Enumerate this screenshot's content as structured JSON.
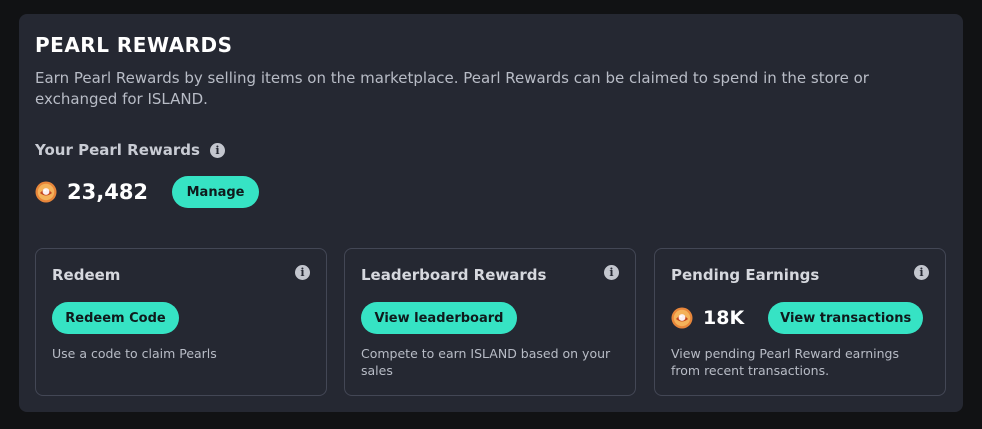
{
  "panel": {
    "title": "PEARL REWARDS",
    "description": "Earn Pearl Rewards by selling items on the marketplace. Pearl Rewards can be claimed to spend in the store or exchanged for ISLAND."
  },
  "your_rewards": {
    "label": "Your Pearl Rewards",
    "balance": "23,482",
    "manage_label": "Manage"
  },
  "cards": [
    {
      "title": "Redeem",
      "button_label": "Redeem Code",
      "text": "Use a code to claim Pearls"
    },
    {
      "title": "Leaderboard Rewards",
      "button_label": "View leaderboard",
      "text": "Compete to earn ISLAND based on your sales"
    },
    {
      "title": "Pending Earnings",
      "pending_value": "18K",
      "button_label": "View transactions",
      "text": "View pending Pearl Reward earnings from recent transactions."
    }
  ],
  "icons": {
    "info": "info-icon",
    "pearl": "pearl-coin-icon"
  },
  "colors": {
    "background": "#111214",
    "panel": "#252832",
    "accent": "#36e3c4",
    "card_border": "#434755"
  }
}
